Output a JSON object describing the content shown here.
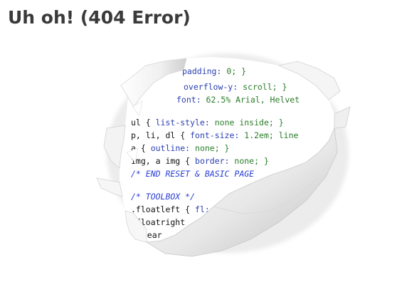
{
  "page": {
    "title": "Uh oh! (404 Error)"
  },
  "colors": {
    "title": "#3a3a3a",
    "code_selector": "#111111",
    "code_property": "#2a3fb0",
    "code_value": "#2a7d2a",
    "code_comment": "#2a3fd6",
    "paper": "#f4f4f4",
    "paper_shadow": "#cfcfcf"
  },
  "code_lines": [
    {
      "selector": "",
      "property": "padding",
      "value": "0; }"
    },
    {
      "selector": "",
      "property": "overflow-y",
      "value": "scroll; }"
    },
    {
      "selector": "",
      "property": "font",
      "value": "62.5% Arial, Helvet"
    },
    {
      "selector": "ul {",
      "property": "list-style",
      "value": "none inside; }"
    },
    {
      "selector": "p, li, dl {",
      "property": "font-size",
      "value": "1.2em; line"
    },
    {
      "selector": "a {",
      "property": "outline",
      "value": "none; }"
    },
    {
      "selector": "img, a img {",
      "property": "border",
      "value": "none; }"
    },
    {
      "comment": "/* END RESET & BASIC PAGE"
    },
    {
      "comment": "/* TOOLBOX */"
    },
    {
      "selector": ".floatleft {",
      "property": "fl",
      "value": ""
    },
    {
      "selector": ".floatright",
      "property": "",
      "value": ""
    },
    {
      "selector": ".clear",
      "property": "",
      "value": ""
    }
  ]
}
